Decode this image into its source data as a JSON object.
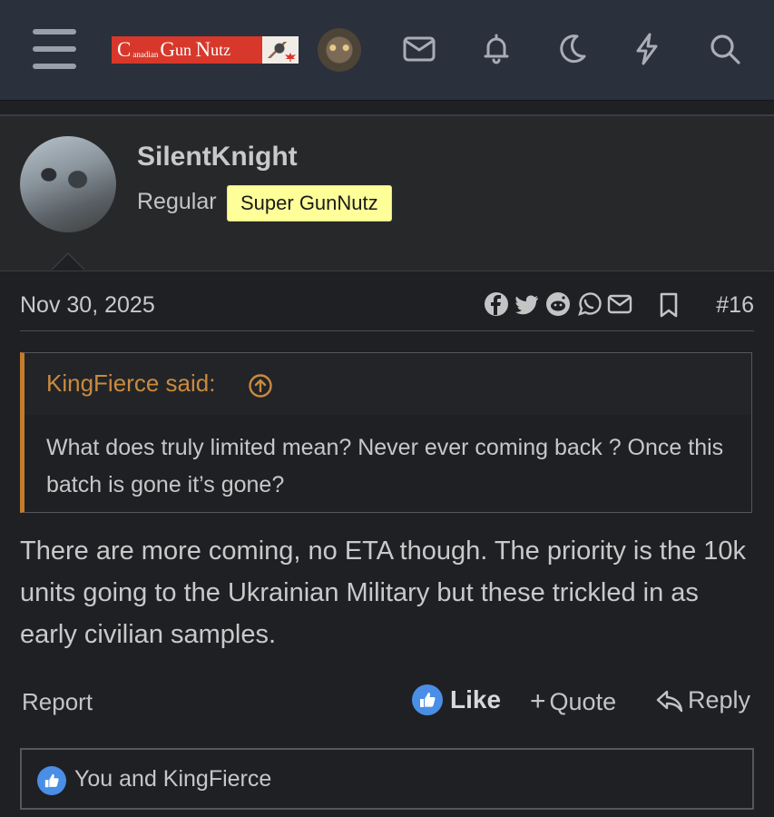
{
  "header": {
    "logo": "Canadian Gun Nutz",
    "icons": [
      "menu-icon",
      "envelope-icon",
      "bell-icon",
      "moon-icon",
      "bolt-icon",
      "search-icon"
    ]
  },
  "post": {
    "author": "SilentKnight",
    "user_title": "Regular",
    "user_banner": "Super GunNutz",
    "date": "Nov 30, 2025",
    "post_number": "#16",
    "share_icons": [
      "facebook-icon",
      "twitter-icon",
      "reddit-icon",
      "whatsapp-icon",
      "email-icon"
    ],
    "quote": {
      "author": "KingFierce said:",
      "text": "What does truly limited mean? Never ever coming back ? Once this batch is gone it’s gone?"
    },
    "body": "There are more coming, no ETA though. The priority is the 10k units going to the Ukrainian Military but these trickled in as early civilian samples.",
    "actions": {
      "report": "Report",
      "like": "Like",
      "quote": "Quote",
      "reply": "Reply"
    },
    "reactions_text": "You and KingFierce"
  },
  "colors": {
    "accent_quote": "#c27c2b",
    "like_blue": "#4a8ee6",
    "banner_yellow": "#ffff99"
  }
}
